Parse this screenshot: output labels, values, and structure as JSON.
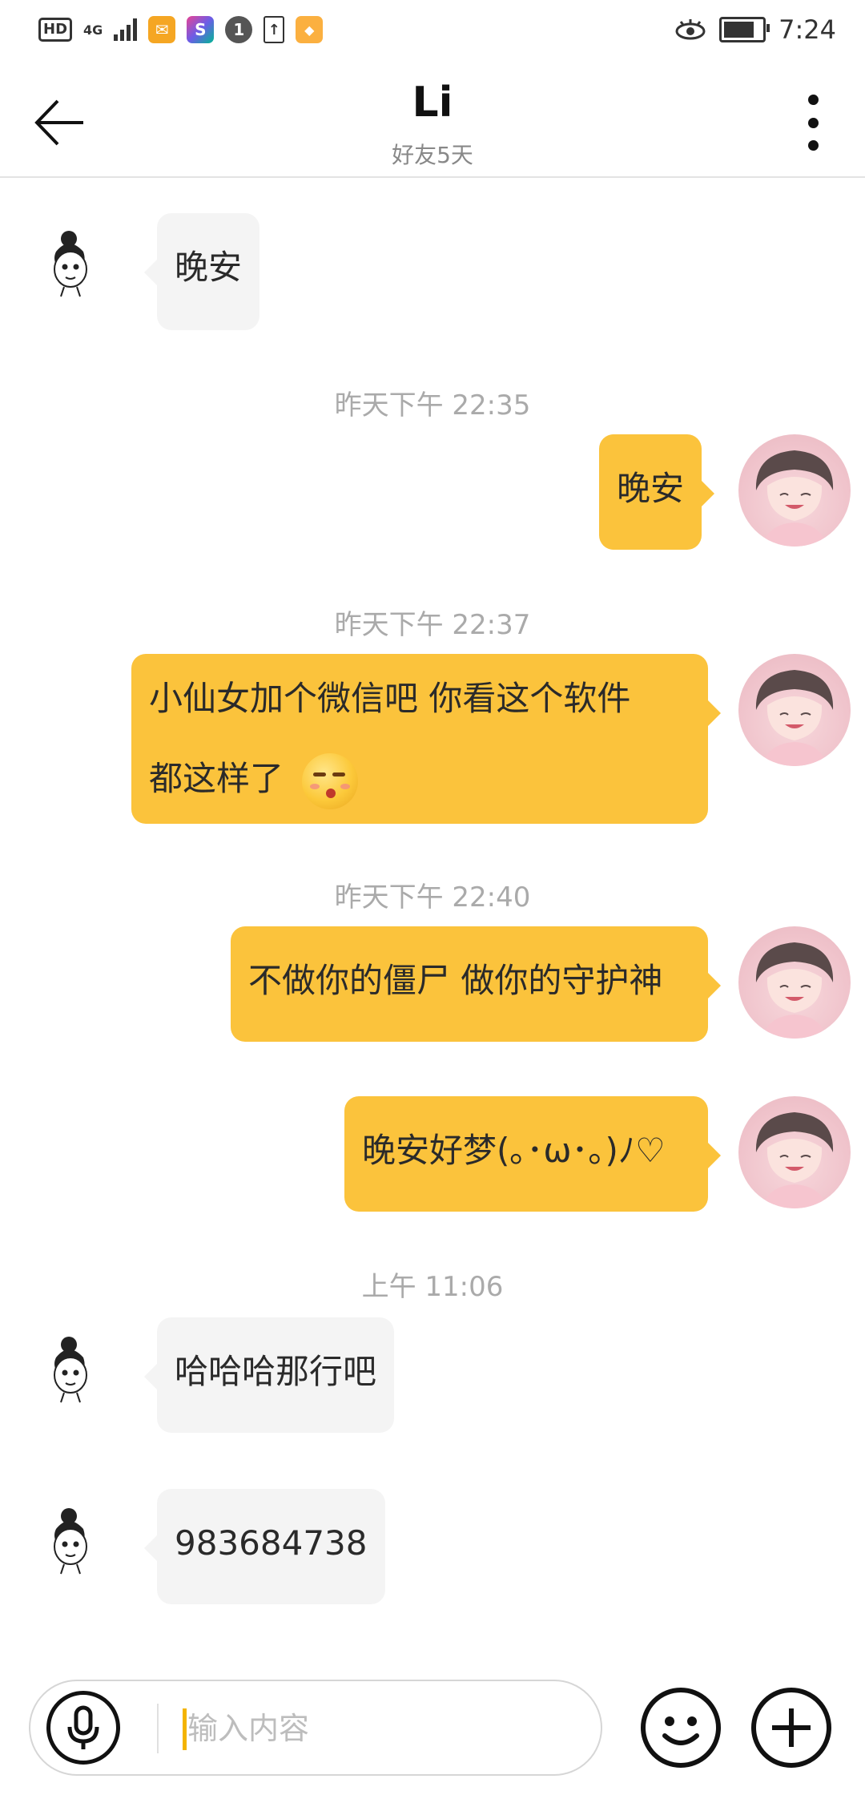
{
  "status_bar": {
    "hd": "HD",
    "network": "4G",
    "time": "7:24",
    "icons": [
      "hd-icon",
      "signal-icon",
      "mail-app-icon",
      "s-app-icon",
      "one-app-icon",
      "upload-icon",
      "bag-app-icon",
      "eye-icon",
      "battery-icon"
    ]
  },
  "header": {
    "title": "Li",
    "subtitle": "好友5天"
  },
  "messages": [
    {
      "side": "left",
      "text": "晚安"
    },
    {
      "timestamp": "昨天下午 22:35"
    },
    {
      "side": "right",
      "text": "晚安"
    },
    {
      "timestamp": "昨天下午 22:37"
    },
    {
      "side": "right",
      "line1": "小仙女加个微信吧 你看这个软件",
      "line2": "都这样了",
      "emoji": "shushing-kiss-emoji"
    },
    {
      "timestamp": "昨天下午 22:40"
    },
    {
      "side": "right",
      "text": "不做你的僵尸 做你的守护神"
    },
    {
      "side": "right",
      "text": "晚安好梦(｡･ω･｡)ﾉ♡"
    },
    {
      "timestamp": "上午 11:06"
    },
    {
      "side": "left",
      "text": "哈哈哈那行吧"
    },
    {
      "side": "left",
      "text": "983684738"
    }
  ],
  "input": {
    "placeholder": "输入内容",
    "value": ""
  },
  "colors": {
    "accent": "#fbc33c",
    "bubble_left": "#f4f4f4",
    "timestamp": "#aaaaaa",
    "cursor": "#f4b400"
  }
}
